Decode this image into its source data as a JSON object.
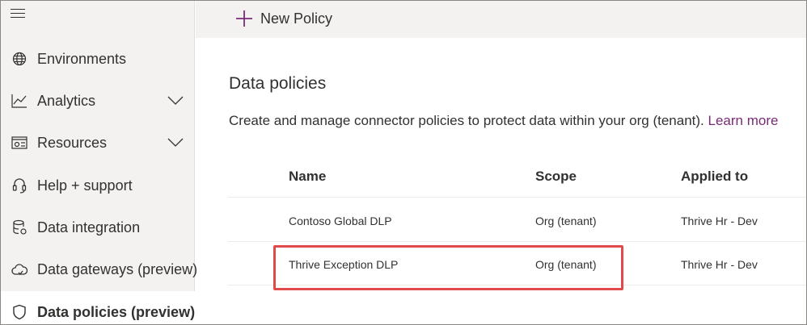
{
  "sidebar": {
    "items": [
      {
        "label": "Environments",
        "icon": "globe-icon",
        "chevron": false
      },
      {
        "label": "Analytics",
        "icon": "chart-line-icon",
        "chevron": true
      },
      {
        "label": "Resources",
        "icon": "resources-icon",
        "chevron": true
      },
      {
        "label": "Help + support",
        "icon": "headset-icon",
        "chevron": false
      },
      {
        "label": "Data integration",
        "icon": "database-icon",
        "chevron": false
      },
      {
        "label": "Data gateways (preview)",
        "icon": "cloud-icon",
        "chevron": false
      },
      {
        "label": "Data policies (preview)",
        "icon": "shield-icon",
        "chevron": false,
        "active": true
      }
    ]
  },
  "toolbar": {
    "new_policy_label": "New Policy"
  },
  "main": {
    "title": "Data policies",
    "description": "Create and manage connector policies to protect data within your org (tenant).",
    "learn_more": "Learn more"
  },
  "table": {
    "columns": [
      "Name",
      "Scope",
      "Applied to"
    ],
    "rows": [
      {
        "name": "Contoso Global DLP",
        "scope": "Org (tenant)",
        "applied_to": "Thrive Hr - Dev"
      },
      {
        "name": "Thrive Exception DLP",
        "scope": "Org (tenant)",
        "applied_to": "Thrive Hr - Dev"
      }
    ]
  },
  "colors": {
    "accent": "#7a2a78",
    "highlight": "#e04a4a",
    "sidebar_bg": "#f3f2f1"
  }
}
